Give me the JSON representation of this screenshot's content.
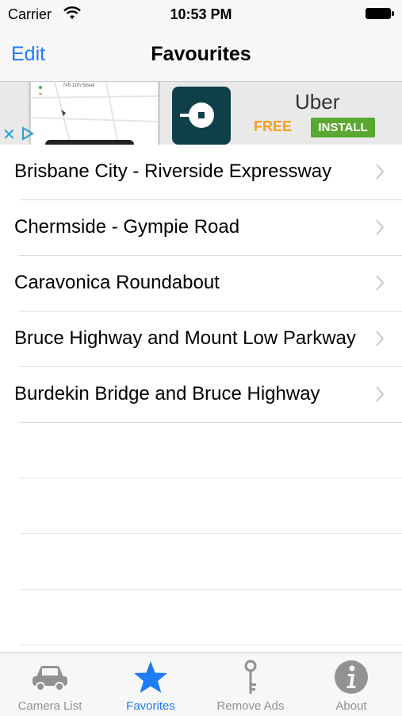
{
  "status": {
    "carrier": "Carrier",
    "time": "10:53 PM"
  },
  "nav": {
    "edit": "Edit",
    "title": "Favourites"
  },
  "ad": {
    "street": "745 11th Street",
    "title": "Uber",
    "free": "FREE",
    "install": "INSTALL"
  },
  "favourites": [
    {
      "label": "Brisbane City - Riverside Expressway"
    },
    {
      "label": "Chermside - Gympie Road"
    },
    {
      "label": "Caravonica Roundabout"
    },
    {
      "label": "Bruce Highway and Mount Low Parkway"
    },
    {
      "label": "Burdekin Bridge and Bruce Highway"
    }
  ],
  "tabs": [
    {
      "label": "Camera List",
      "icon": "car-icon",
      "active": false
    },
    {
      "label": "Favorites",
      "icon": "star-icon",
      "active": true
    },
    {
      "label": "Remove Ads",
      "icon": "key-icon",
      "active": false
    },
    {
      "label": "About",
      "icon": "info-icon",
      "active": false
    }
  ],
  "colors": {
    "accent": "#1f7bf6",
    "inactive": "#929292",
    "install": "#5aa832",
    "free": "#f0a020"
  }
}
